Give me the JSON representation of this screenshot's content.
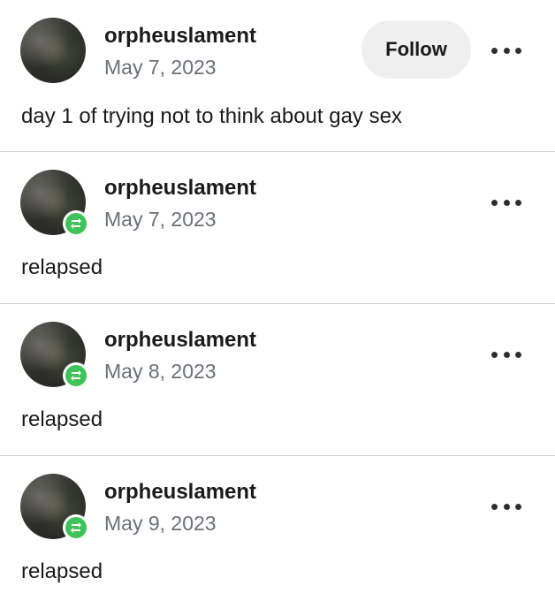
{
  "posts": [
    {
      "username": "orpheuslament",
      "date": "May 7, 2023",
      "content": "day 1 of trying not to think about gay sex",
      "follow_label": "Follow",
      "reblog": false
    },
    {
      "username": "orpheuslament",
      "date": "May 7, 2023",
      "content": "relapsed",
      "reblog": true
    },
    {
      "username": "orpheuslament",
      "date": "May 8, 2023",
      "content": "relapsed",
      "reblog": true
    },
    {
      "username": "orpheuslament",
      "date": "May 9, 2023",
      "content": "relapsed",
      "reblog": true
    }
  ],
  "icons": {
    "more": "more-options-icon",
    "reblog": "reblog-icon",
    "reblog_color": "#3ec35a"
  }
}
